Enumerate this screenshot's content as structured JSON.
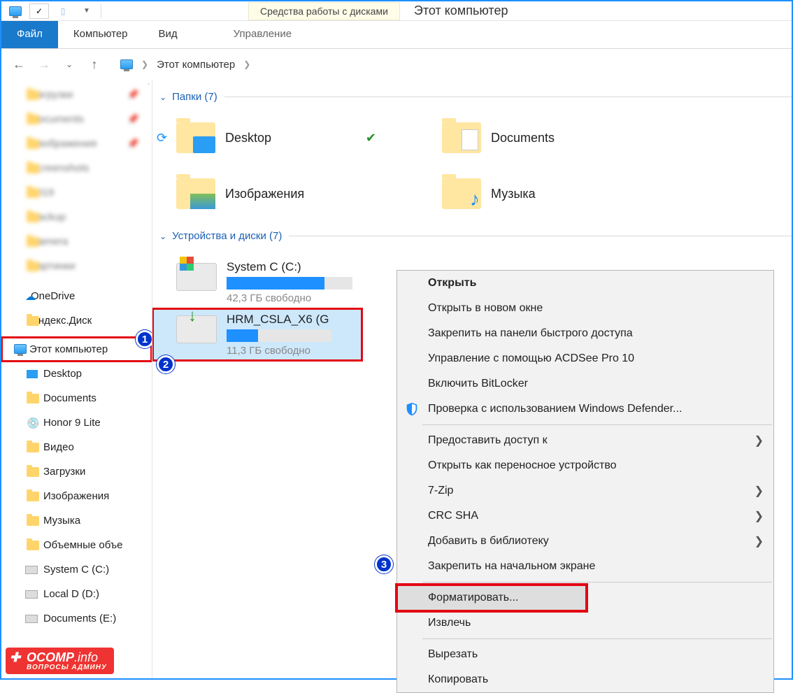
{
  "titlebar": {
    "context_tools": "Средства работы с дисками",
    "title": "Этот компьютер"
  },
  "ribbon": {
    "file": "Файл",
    "computer": "Компьютер",
    "view": "Вид",
    "manage": "Управление"
  },
  "address": {
    "this_pc": "Этот компьютер"
  },
  "sidebar_top": [
    "Загрузки",
    "Documents",
    "Изображения",
    "Screenshots",
    "2019",
    "Backup",
    "Camera",
    "Картинки"
  ],
  "sidebar": {
    "onedrive": "OneDrive",
    "yadisk": "Яндекс.Диск",
    "thispc": "Этот компьютер",
    "items": [
      "Desktop",
      "Documents",
      "Honor 9 Lite",
      "Видео",
      "Загрузки",
      "Изображения",
      "Музыка",
      "Объемные объе",
      "System C (C:)",
      "Local D (D:)",
      "Documents (E:)"
    ]
  },
  "groups": {
    "folders": "Папки (7)",
    "devices": "Устройства и диски (7)"
  },
  "folders": {
    "desktop": "Desktop",
    "documents": "Documents",
    "images": "Изображения",
    "music": "Музыка"
  },
  "drives": {
    "sysc": {
      "name": "System C (C:)",
      "free": "42,3 ГБ свободно",
      "fill_pct": 78
    },
    "usb": {
      "name": "HRM_CSLA_X6 (G",
      "free": "11,3 ГБ свободно",
      "fill_pct": 30
    }
  },
  "ctxmenu": {
    "open": "Открыть",
    "open_new": "Открыть в новом окне",
    "pin_quick": "Закрепить на панели быстрого доступа",
    "acdsee": "Управление с помощью ACDSee Pro 10",
    "bitlocker": "Включить BitLocker",
    "defender": "Проверка с использованием Windows Defender...",
    "share": "Предоставить доступ к",
    "portable": "Открыть как переносное устройство",
    "sevenzip": "7-Zip",
    "crcsha": "CRC SHA",
    "addlib": "Добавить в библиотеку",
    "pin_start": "Закрепить на начальном экране",
    "format": "Форматировать...",
    "eject": "Извлечь",
    "cut": "Вырезать",
    "copy": "Копировать"
  },
  "badges": {
    "b1": "1",
    "b2": "2",
    "b3": "3"
  },
  "watermark": {
    "main": "OCOMP",
    "info": ".info",
    "sub": "ВОПРОСЫ АДМИНУ"
  }
}
